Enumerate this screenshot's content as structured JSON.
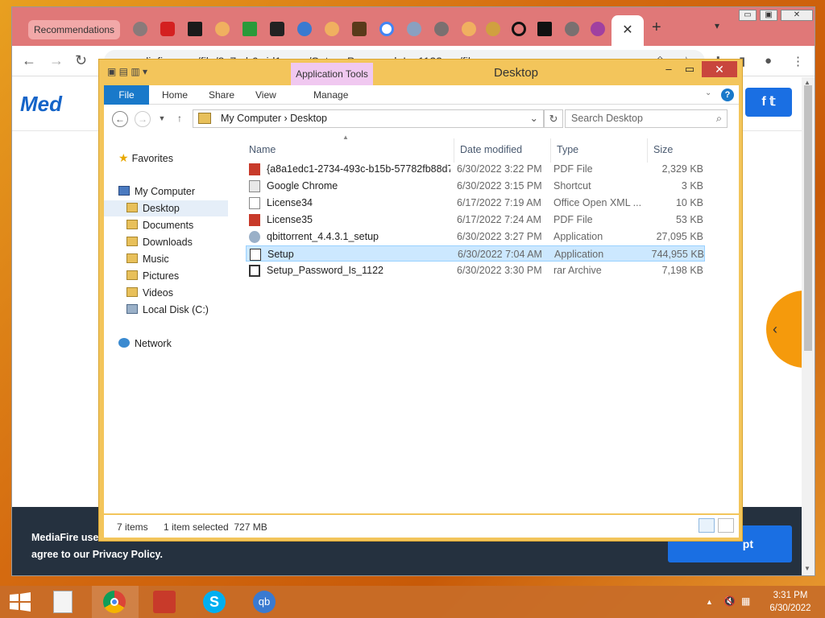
{
  "browser": {
    "recommendations_label": "Recommendations",
    "active_tab_close": "✕",
    "new_tab": "+",
    "url": "mediafire.com/file/8c7srb6wid1comx/Setup_Password_Is_1122.rar/file",
    "window_controls": [
      "▭",
      "▣",
      "✕"
    ]
  },
  "mediafire": {
    "logo_text": "Med",
    "social": "f 𝕥",
    "cookie_text_1": "MediaFire use",
    "cookie_text_2": "agree to our Privacy Policy.",
    "accept_label": "pt"
  },
  "explorer": {
    "title": "Desktop",
    "app_tools": "Application Tools",
    "ribbon_tabs": [
      "File",
      "Home",
      "Share",
      "View",
      "Manage"
    ],
    "breadcrumb": [
      "My Computer",
      "Desktop"
    ],
    "search_placeholder": "Search Desktop",
    "nav": {
      "favorites": "Favorites",
      "my_computer": "My Computer",
      "items": [
        "Desktop",
        "Documents",
        "Downloads",
        "Music",
        "Pictures",
        "Videos",
        "Local Disk (C:)"
      ],
      "network": "Network"
    },
    "columns": [
      "Name",
      "Date modified",
      "Type",
      "Size"
    ],
    "files": [
      {
        "name": "{a8a1edc1-2734-493c-b15b-57782fb88d7...",
        "date": "6/30/2022 3:22 PM",
        "type": "PDF File",
        "size": "2,329 KB",
        "icon": "pdf-icon"
      },
      {
        "name": "Google Chrome",
        "date": "6/30/2022 3:15 PM",
        "type": "Shortcut",
        "size": "3 KB",
        "icon": "chrome-icon"
      },
      {
        "name": "License34",
        "date": "6/17/2022 7:19 AM",
        "type": "Office Open XML ...",
        "size": "10 KB",
        "icon": "document-icon"
      },
      {
        "name": "License35",
        "date": "6/17/2022 7:24 AM",
        "type": "PDF File",
        "size": "53 KB",
        "icon": "pdf-icon"
      },
      {
        "name": "qbittorrent_4.4.3.1_setup",
        "date": "6/30/2022 3:27 PM",
        "type": "Application",
        "size": "27,095 KB",
        "icon": "qbittorrent-icon"
      },
      {
        "name": "Setup",
        "date": "6/30/2022 7:04 AM",
        "type": "Application",
        "size": "744,955 KB",
        "icon": "setup-icon"
      },
      {
        "name": "Setup_Password_Is_1122",
        "date": "6/30/2022 3:30 PM",
        "type": "rar Archive",
        "size": "7,198 KB",
        "icon": "rar-icon"
      }
    ],
    "selected_index": 5,
    "status_items": "7 items",
    "status_selected": "1 item selected  727 MB"
  },
  "taskbar": {
    "clock_time": "3:31 PM",
    "clock_date": "6/30/2022"
  },
  "colors": {
    "tabstrip": "#e07878",
    "explorer_frame": "#f3c55b",
    "ribbon_file": "#1979ca",
    "selection": "#cce8ff",
    "mediafire_blue": "#1a6fe3"
  }
}
